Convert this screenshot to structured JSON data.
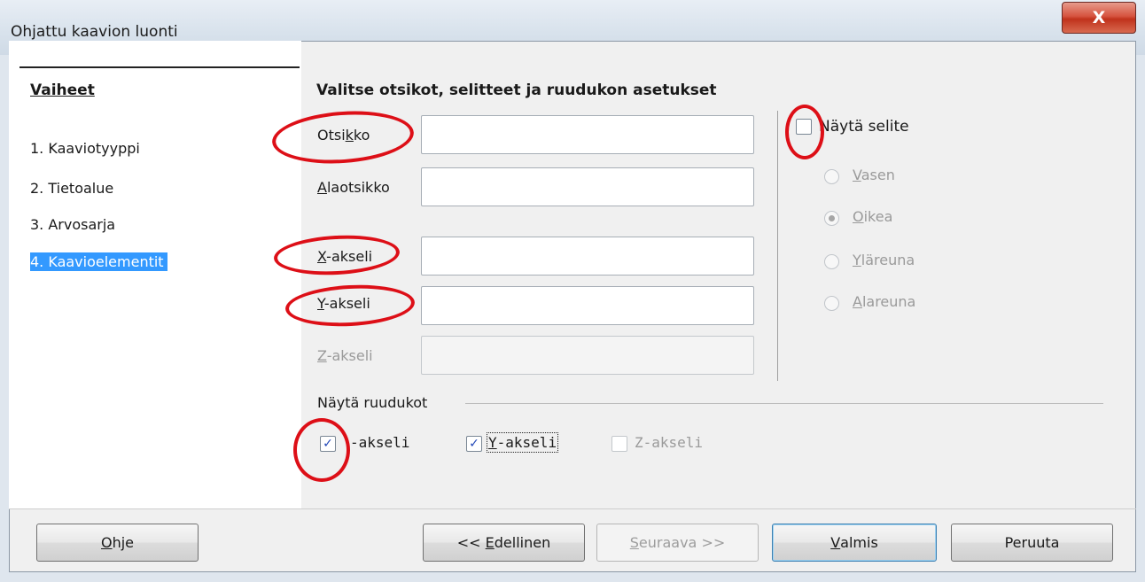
{
  "window": {
    "title": "Ohjattu kaavion luonti",
    "close_glyph": "X"
  },
  "steps": {
    "heading": "Vaiheet",
    "items": [
      {
        "label": "1. Kaaviotyyppi"
      },
      {
        "label": "2. Tietoalue"
      },
      {
        "label": "3. Arvosarja"
      },
      {
        "label": "4. Kaavioelementit",
        "active": true
      }
    ]
  },
  "main": {
    "heading": "Valitse otsikot, selitteet ja ruudukon asetukset",
    "fields": {
      "title": {
        "pre": "Otsi",
        "key": "k",
        "post": "ko",
        "value": ""
      },
      "subtitle": {
        "pre": "",
        "key": "A",
        "post": "laotsikko",
        "value": ""
      },
      "x_axis": {
        "pre": "",
        "key": "X",
        "post": "-akseli",
        "value": ""
      },
      "y_axis": {
        "pre": "",
        "key": "Y",
        "post": "-akseli",
        "value": ""
      },
      "z_axis": {
        "pre": "",
        "key": "Z",
        "post": "-akseli",
        "value": "",
        "disabled": true
      }
    }
  },
  "legend": {
    "show_label": "Näytä selite",
    "checked": false,
    "positions": [
      {
        "key": "V",
        "rest": "asen",
        "checked": false
      },
      {
        "key": "O",
        "rest": "ikea",
        "checked": true
      },
      {
        "key": "Y",
        "rest": "läreuna",
        "checked": false
      },
      {
        "key": "A",
        "rest": "lareuna",
        "checked": false
      }
    ]
  },
  "grids": {
    "heading": "Näytä ruudukot",
    "x": {
      "label": "-akseli",
      "checked": true
    },
    "y": {
      "key": "Y",
      "rest": "-akseli",
      "checked": true
    },
    "z": {
      "label": "Z-akseli",
      "checked": false,
      "disabled": true
    }
  },
  "buttons": {
    "help": {
      "key": "O",
      "rest": "hje"
    },
    "back": {
      "pre": "<< ",
      "key": "E",
      "rest": "dellinen"
    },
    "next": {
      "key": "S",
      "rest": "euraava >>",
      "disabled": true
    },
    "finish": {
      "key": "V",
      "rest": "almis"
    },
    "cancel": {
      "label": "Peruuta"
    }
  },
  "colors": {
    "annotation_circle": "#dd0f17",
    "selection": "#3399ff",
    "close_button": "#c0321c"
  }
}
